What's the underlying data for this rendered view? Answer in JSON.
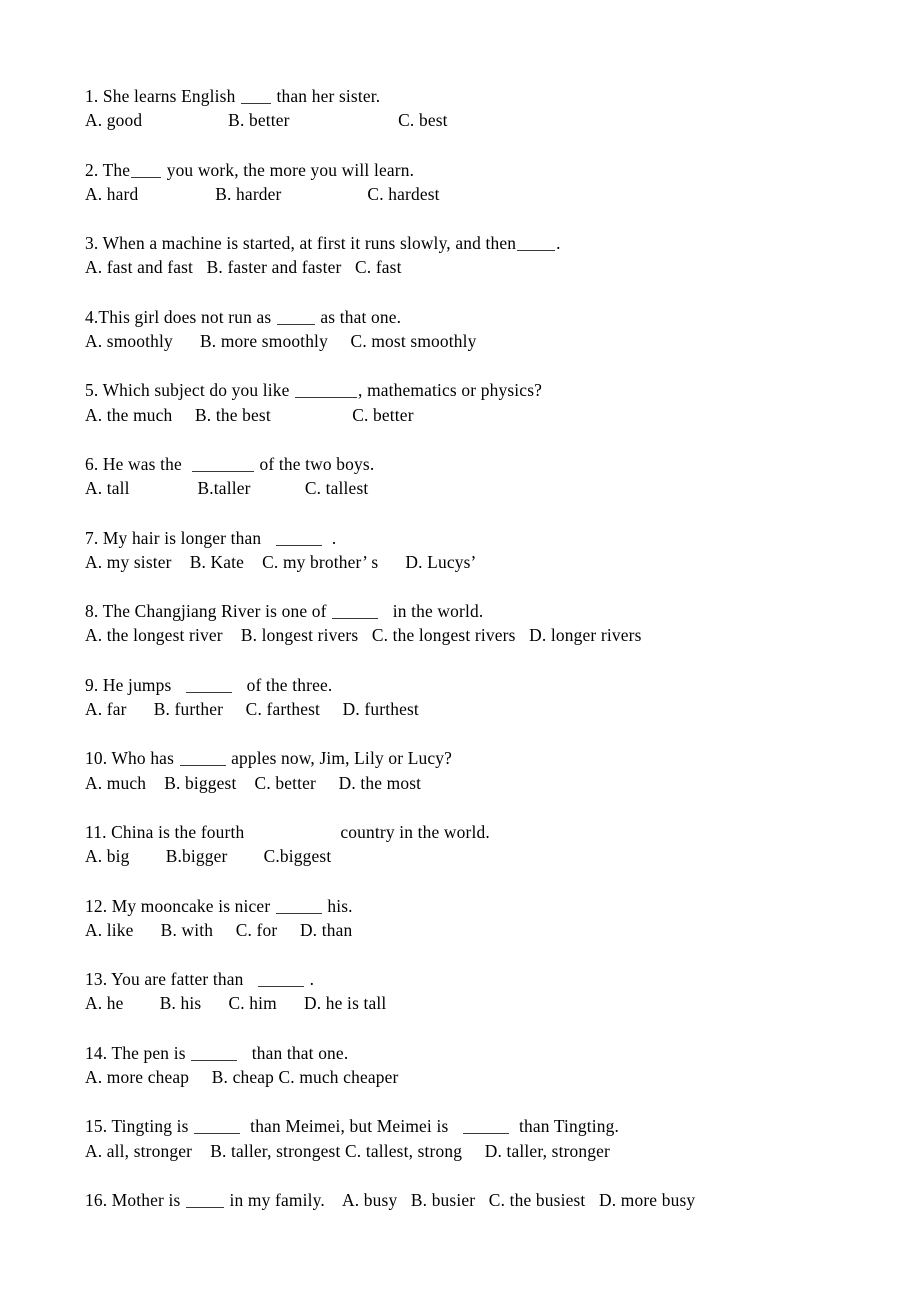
{
  "document": {
    "kind": "worksheet",
    "title": "",
    "background_color": "#ffffff",
    "text_color": "#000000"
  },
  "questions": [
    {
      "id": "q1",
      "number": "1.",
      "stem_before": "1. She learns English ",
      "blank": "b3",
      "stem_after": " than her sister.",
      "options_line": "A. good                   B. better                        C. best",
      "options": [
        "A. good",
        "B. better",
        "C. best"
      ]
    },
    {
      "id": "q2",
      "number": "2.",
      "stem_before": "2. The",
      "blank": "b3",
      "stem_after": " you work, the more you will learn.",
      "options_line": "A. hard                 B. harder                   C. hardest",
      "options": [
        "A. hard",
        "B. harder",
        "C. hardest"
      ]
    },
    {
      "id": "q3",
      "number": "3.",
      "stem_before": "3. When a machine is started, at first it runs slowly, and then",
      "blank": "b4",
      "stem_after": ".",
      "options_line": "A. fast and fast   B. faster and faster   C. fast",
      "options": [
        "A. fast and fast",
        "B. faster and faster",
        "C. fast"
      ]
    },
    {
      "id": "q4",
      "number": "4.",
      "stem_before": "4.This girl does not run as ",
      "blank": "b4",
      "stem_after": " as that one.",
      "options_line": "A. smoothly      B. more smoothly     C. most smoothly",
      "options": [
        "A. smoothly",
        "B. more smoothly",
        "C. most smoothly"
      ]
    },
    {
      "id": "q5",
      "number": "5.",
      "stem_before": "5. Which subject do you like ",
      "blank": "b7",
      "stem_after": ", mathematics or physics?",
      "options_line": "A. the much     B. the best                  C. better",
      "options": [
        "A. the much",
        "B. the best",
        "C. better"
      ]
    },
    {
      "id": "q6",
      "number": "6.",
      "stem_before": "6. He was the  ",
      "blank": "b7",
      "stem_after": " of the two boys.",
      "options_line": "A. tall               B.taller            C. tallest",
      "options": [
        "A. tall",
        "B.taller",
        "C. tallest"
      ]
    },
    {
      "id": "q7",
      "number": "7.",
      "stem_before": "7. My hair is longer than   ",
      "blank": "b5",
      "stem_after": "  .",
      "options_line": "A. my sister    B. Kate    C. my brother’ s      D. Lucys’",
      "options": [
        "A. my sister",
        "B. Kate",
        "C. my brother’ s",
        "D. Lucys’"
      ]
    },
    {
      "id": "q8",
      "number": "8.",
      "stem_before": "8. The Changjiang River is one of ",
      "blank": "b5",
      "stem_after": "   in the world.",
      "options_line": "A. the longest river    B. longest rivers   C. the longest rivers   D. longer rivers",
      "options": [
        "A. the longest river",
        "B. longest rivers",
        "C. the longest rivers",
        "D. longer rivers"
      ]
    },
    {
      "id": "q9",
      "number": "9.",
      "stem_before": "9. He jumps   ",
      "blank": "b5",
      "stem_after": "   of the three.",
      "options_line": "A. far      B. further     C. farthest     D. furthest",
      "options": [
        "A. far",
        "B. further",
        "C. farthest",
        "D. furthest"
      ]
    },
    {
      "id": "q10",
      "number": "10.",
      "stem_before": "10. Who has ",
      "blank": "b5",
      "stem_after": " apples now, Jim, Lily or Lucy?",
      "options_line": "A. much    B. biggest    C. better     D. the most",
      "options": [
        "A. much",
        "B. biggest",
        "C. better",
        "D. the most"
      ]
    },
    {
      "id": "q11",
      "number": "11.",
      "stem_before": "11. China is the fourth",
      "blank": "g11",
      "stem_after": "country in the world.",
      "options_line": "A. big        B.bigger        C.biggest",
      "options": [
        "A. big",
        "B.bigger",
        "C.biggest"
      ]
    },
    {
      "id": "q12",
      "number": "12.",
      "stem_before": "12. My mooncake is nicer ",
      "blank": "b5",
      "stem_after": " his.",
      "options_line": "A. like      B. with     C. for     D. than",
      "options": [
        "A. like",
        "B. with",
        "C. for",
        "D. than"
      ]
    },
    {
      "id": "q13",
      "number": "13.",
      "stem_before": "13. You are fatter than   ",
      "blank": "b5",
      "stem_after": " .",
      "options_line": "A. he        B. his      C. him      D. he is tall",
      "options": [
        "A. he",
        "B. his",
        "C. him",
        "D. he is tall"
      ]
    },
    {
      "id": "q14",
      "number": "14.",
      "stem_before": "14. The pen is ",
      "blank": "b5",
      "stem_after": "   than that one.",
      "options_line": "A. more cheap     B. cheap C. much cheaper",
      "options": [
        "A. more cheap",
        "B. cheap",
        "C. much cheaper"
      ]
    },
    {
      "id": "q15",
      "number": "15.",
      "stem_before": "15. Tingting is ",
      "blank": "b5",
      "stem_mid": "  than Meimei, but Meimei is   ",
      "blank2": "b5",
      "stem_after": "  than Tingting.",
      "options_line": "A. all, stronger    B. taller, strongest C. tallest, strong     D. taller, stronger",
      "options": [
        "A. all, stronger",
        "B. taller, strongest",
        "C. tallest, strong",
        "D. taller, stronger"
      ]
    },
    {
      "id": "q16",
      "number": "16.",
      "stem_before": "16. Mother is ",
      "blank": "b4",
      "stem_after": " in my family.    A. busy   B. busier   C. the busiest   D. more busy",
      "options_line": "",
      "options": [
        "A. busy",
        "B. busier",
        "C. the busiest",
        "D. more busy"
      ]
    }
  ]
}
